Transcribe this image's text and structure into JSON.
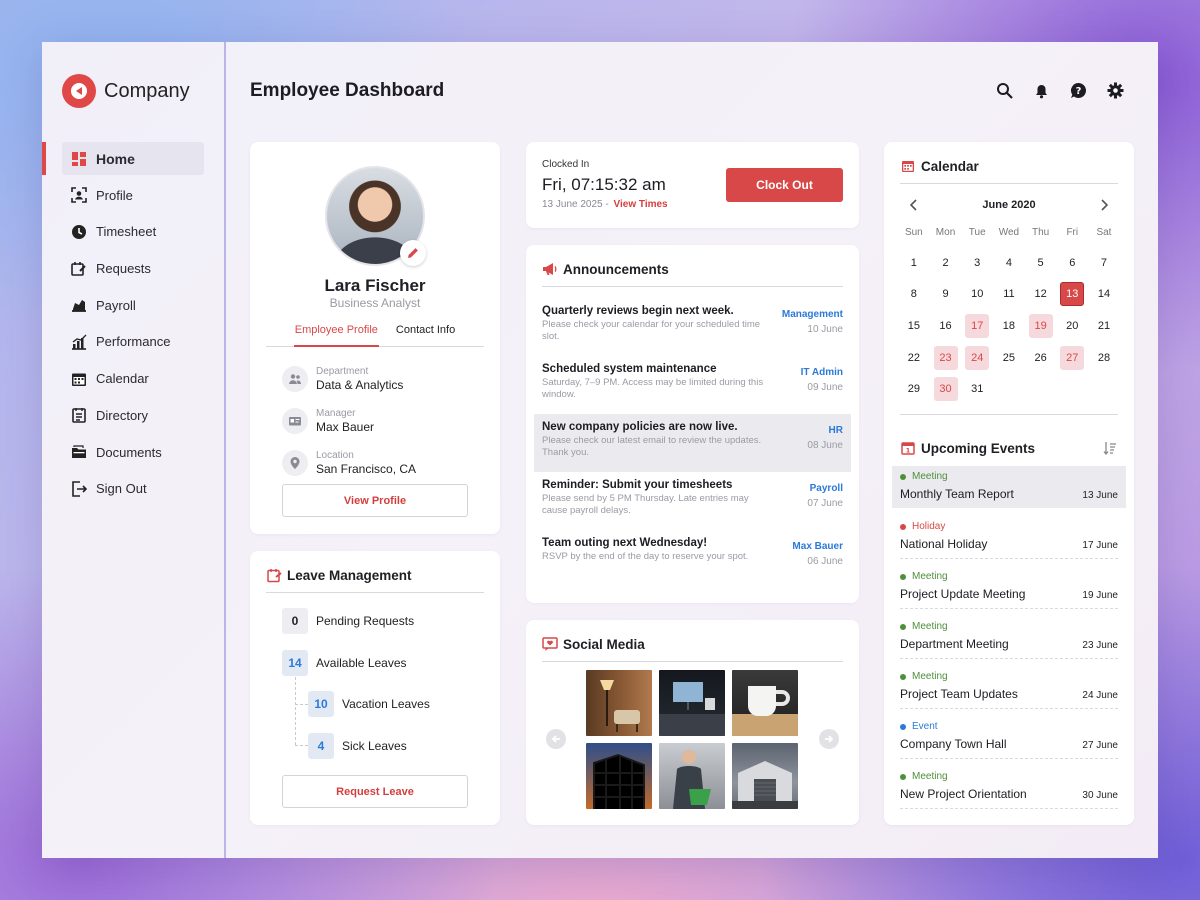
{
  "brand": {
    "name": "Company",
    "color": "#e04848"
  },
  "sidebar": {
    "items": [
      {
        "label": "Home",
        "icon": "dashboard-icon"
      },
      {
        "label": "Profile",
        "icon": "profile-icon"
      },
      {
        "label": "Timesheet",
        "icon": "clock-icon"
      },
      {
        "label": "Requests",
        "icon": "requests-icon"
      },
      {
        "label": "Payroll",
        "icon": "payroll-icon"
      },
      {
        "label": "Performance",
        "icon": "chart-icon"
      },
      {
        "label": "Calendar",
        "icon": "calendar-icon"
      },
      {
        "label": "Directory",
        "icon": "directory-icon"
      },
      {
        "label": "Documents",
        "icon": "documents-icon"
      },
      {
        "label": "Sign Out",
        "icon": "sign-out-icon"
      }
    ]
  },
  "header": {
    "title": "Employee Dashboard",
    "icons": [
      "search-icon",
      "bell-icon",
      "help-icon",
      "gear-icon"
    ]
  },
  "profile": {
    "name": "Lara Fischer",
    "role": "Business Analyst",
    "tabs": [
      "Employee Profile",
      "Contact Info"
    ],
    "fields": [
      {
        "label": "Department",
        "value": "Data & Analytics",
        "icon": "people-icon"
      },
      {
        "label": "Manager",
        "value": "Max Bauer",
        "icon": "id-card-icon"
      },
      {
        "label": "Location",
        "value": "San Francisco, CA",
        "icon": "location-pin-icon"
      }
    ],
    "button": "View Profile"
  },
  "leave": {
    "title": "Leave Management",
    "pending": {
      "count": "0",
      "label": "Pending Requests"
    },
    "available": {
      "count": "14",
      "label": "Available Leaves"
    },
    "vacation": {
      "count": "10",
      "label": "Vacation Leaves"
    },
    "sick": {
      "count": "4",
      "label": "Sick Leaves"
    },
    "button": "Request Leave"
  },
  "clock": {
    "label": "Clocked In",
    "time": "Fri, 07:15:32 am",
    "date": "13 June 2025 -",
    "link": "View Times",
    "button": "Clock Out"
  },
  "announcements": {
    "title": "Announcements",
    "items": [
      {
        "title": "Quarterly reviews begin next week.",
        "body": "Please check your calendar for your scheduled time slot.",
        "tag": "Management",
        "date": "10 June"
      },
      {
        "title": "Scheduled system maintenance",
        "body": "Saturday, 7–9 PM. Access may be limited during this window.",
        "tag": "IT Admin",
        "date": "09 June"
      },
      {
        "title": "New company policies are now live.",
        "body": "Please check our latest email to review the updates. Thank you.",
        "tag": "HR",
        "date": "08 June"
      },
      {
        "title": "Reminder: Submit your timesheets",
        "body": "Please send by 5 PM Thursday. Late entries may cause payroll delays.",
        "tag": "Payroll",
        "date": "07 June"
      },
      {
        "title": "Team outing next Wednesday!",
        "body": "RSVP by the end of the day to reserve your spot.",
        "tag": "Max Bauer",
        "date": "06 June"
      }
    ]
  },
  "social": {
    "title": "Social Media"
  },
  "calendar": {
    "title": "Calendar",
    "month": "June 2020",
    "weekdays": [
      "Sun",
      "Mon",
      "Tue",
      "Wed",
      "Thu",
      "Fri",
      "Sat"
    ],
    "weeks": [
      [
        "1",
        "2",
        "3",
        "4",
        "5",
        "6",
        "7"
      ],
      [
        "8",
        "9",
        "10",
        "11",
        "12",
        "13",
        "14"
      ],
      [
        "15",
        "16",
        "17",
        "18",
        "19",
        "20",
        "21"
      ],
      [
        "22",
        "23",
        "24",
        "25",
        "26",
        "27",
        "28"
      ],
      [
        "29",
        "30",
        "31",
        "",
        "",
        "",
        ""
      ]
    ],
    "marked": [
      "17",
      "19",
      "23",
      "24",
      "27",
      "30"
    ],
    "today": "13"
  },
  "events": {
    "title": "Upcoming Events",
    "colors": {
      "Meeting": "#4e8f3a",
      "Holiday": "#d94848",
      "Event": "#2b7ad8"
    },
    "items": [
      {
        "type": "Meeting",
        "name": "Monthly Team Report",
        "date": "13 June"
      },
      {
        "type": "Holiday",
        "name": "National Holiday",
        "date": "17 June"
      },
      {
        "type": "Meeting",
        "name": "Project Update Meeting",
        "date": "19 June"
      },
      {
        "type": "Meeting",
        "name": "Department Meeting",
        "date": "23 June"
      },
      {
        "type": "Meeting",
        "name": "Project Team Updates",
        "date": "24 June"
      },
      {
        "type": "Event",
        "name": "Company Town Hall",
        "date": "27 June"
      },
      {
        "type": "Meeting",
        "name": "New Project Orientation",
        "date": "30 June"
      }
    ]
  }
}
